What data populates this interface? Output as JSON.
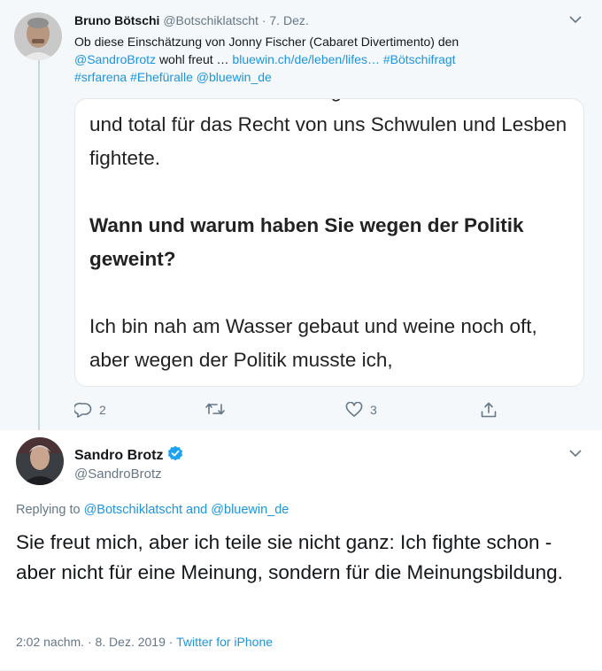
{
  "parent_tweet": {
    "author_name": "Bruno Bötschi",
    "author_handle": "@Botschiklatscht",
    "separator": "·",
    "date": "7. Dez.",
    "text_intro": "Ob diese Einschätzung von Jonny Fischer (Cabaret Divertimento) den",
    "mention": "@SandroBrotz",
    "text_mid": "wohl freut …",
    "link": "bluewin.ch/de/leben/lifes…",
    "hashtags": [
      "#Bötschifragt",
      "#srfarena",
      "#Ehefüralle"
    ],
    "mention_end": "@bluewin_de",
    "card": {
      "cut_line": "vermehrt der Schweiz bezogen hat",
      "para1": "und total für das Recht von uns Schwulen und Lesben fightete.",
      "question": "Wann und warum haben Sie wegen der Politik geweint?",
      "para2": "Ich bin nah am Wasser gebaut und weine noch oft, aber wegen der Politik musste ich,"
    },
    "actions": {
      "reply_count": "2",
      "retweet_count": "",
      "like_count": "3"
    }
  },
  "reply_tweet": {
    "author_name": "Sandro Brotz",
    "author_handle": "@SandroBrotz",
    "replying_prefix": "Replying to",
    "replying_to_1": "@Botschiklatscht",
    "replying_and": "and",
    "replying_to_2": "@bluewin_de",
    "text": "Sie freut mich, aber ich teile sie nicht ganz: Ich fighte schon - aber nicht für eine Meinung, sondern für die Meinungsbildung.",
    "timestamp": "2:02 nachm. · 8. Dez. 2019",
    "meta_separator": "·",
    "source": "Twitter for iPhone"
  },
  "colors": {
    "link": "#1b95e0",
    "secondary_text": "#657786",
    "parent_bg": "#f5f8fa",
    "verified": "#1da1f2"
  },
  "icons": [
    "chevron-down-icon",
    "reply-icon",
    "retweet-icon",
    "like-icon",
    "share-icon",
    "verified-badge-icon"
  ]
}
